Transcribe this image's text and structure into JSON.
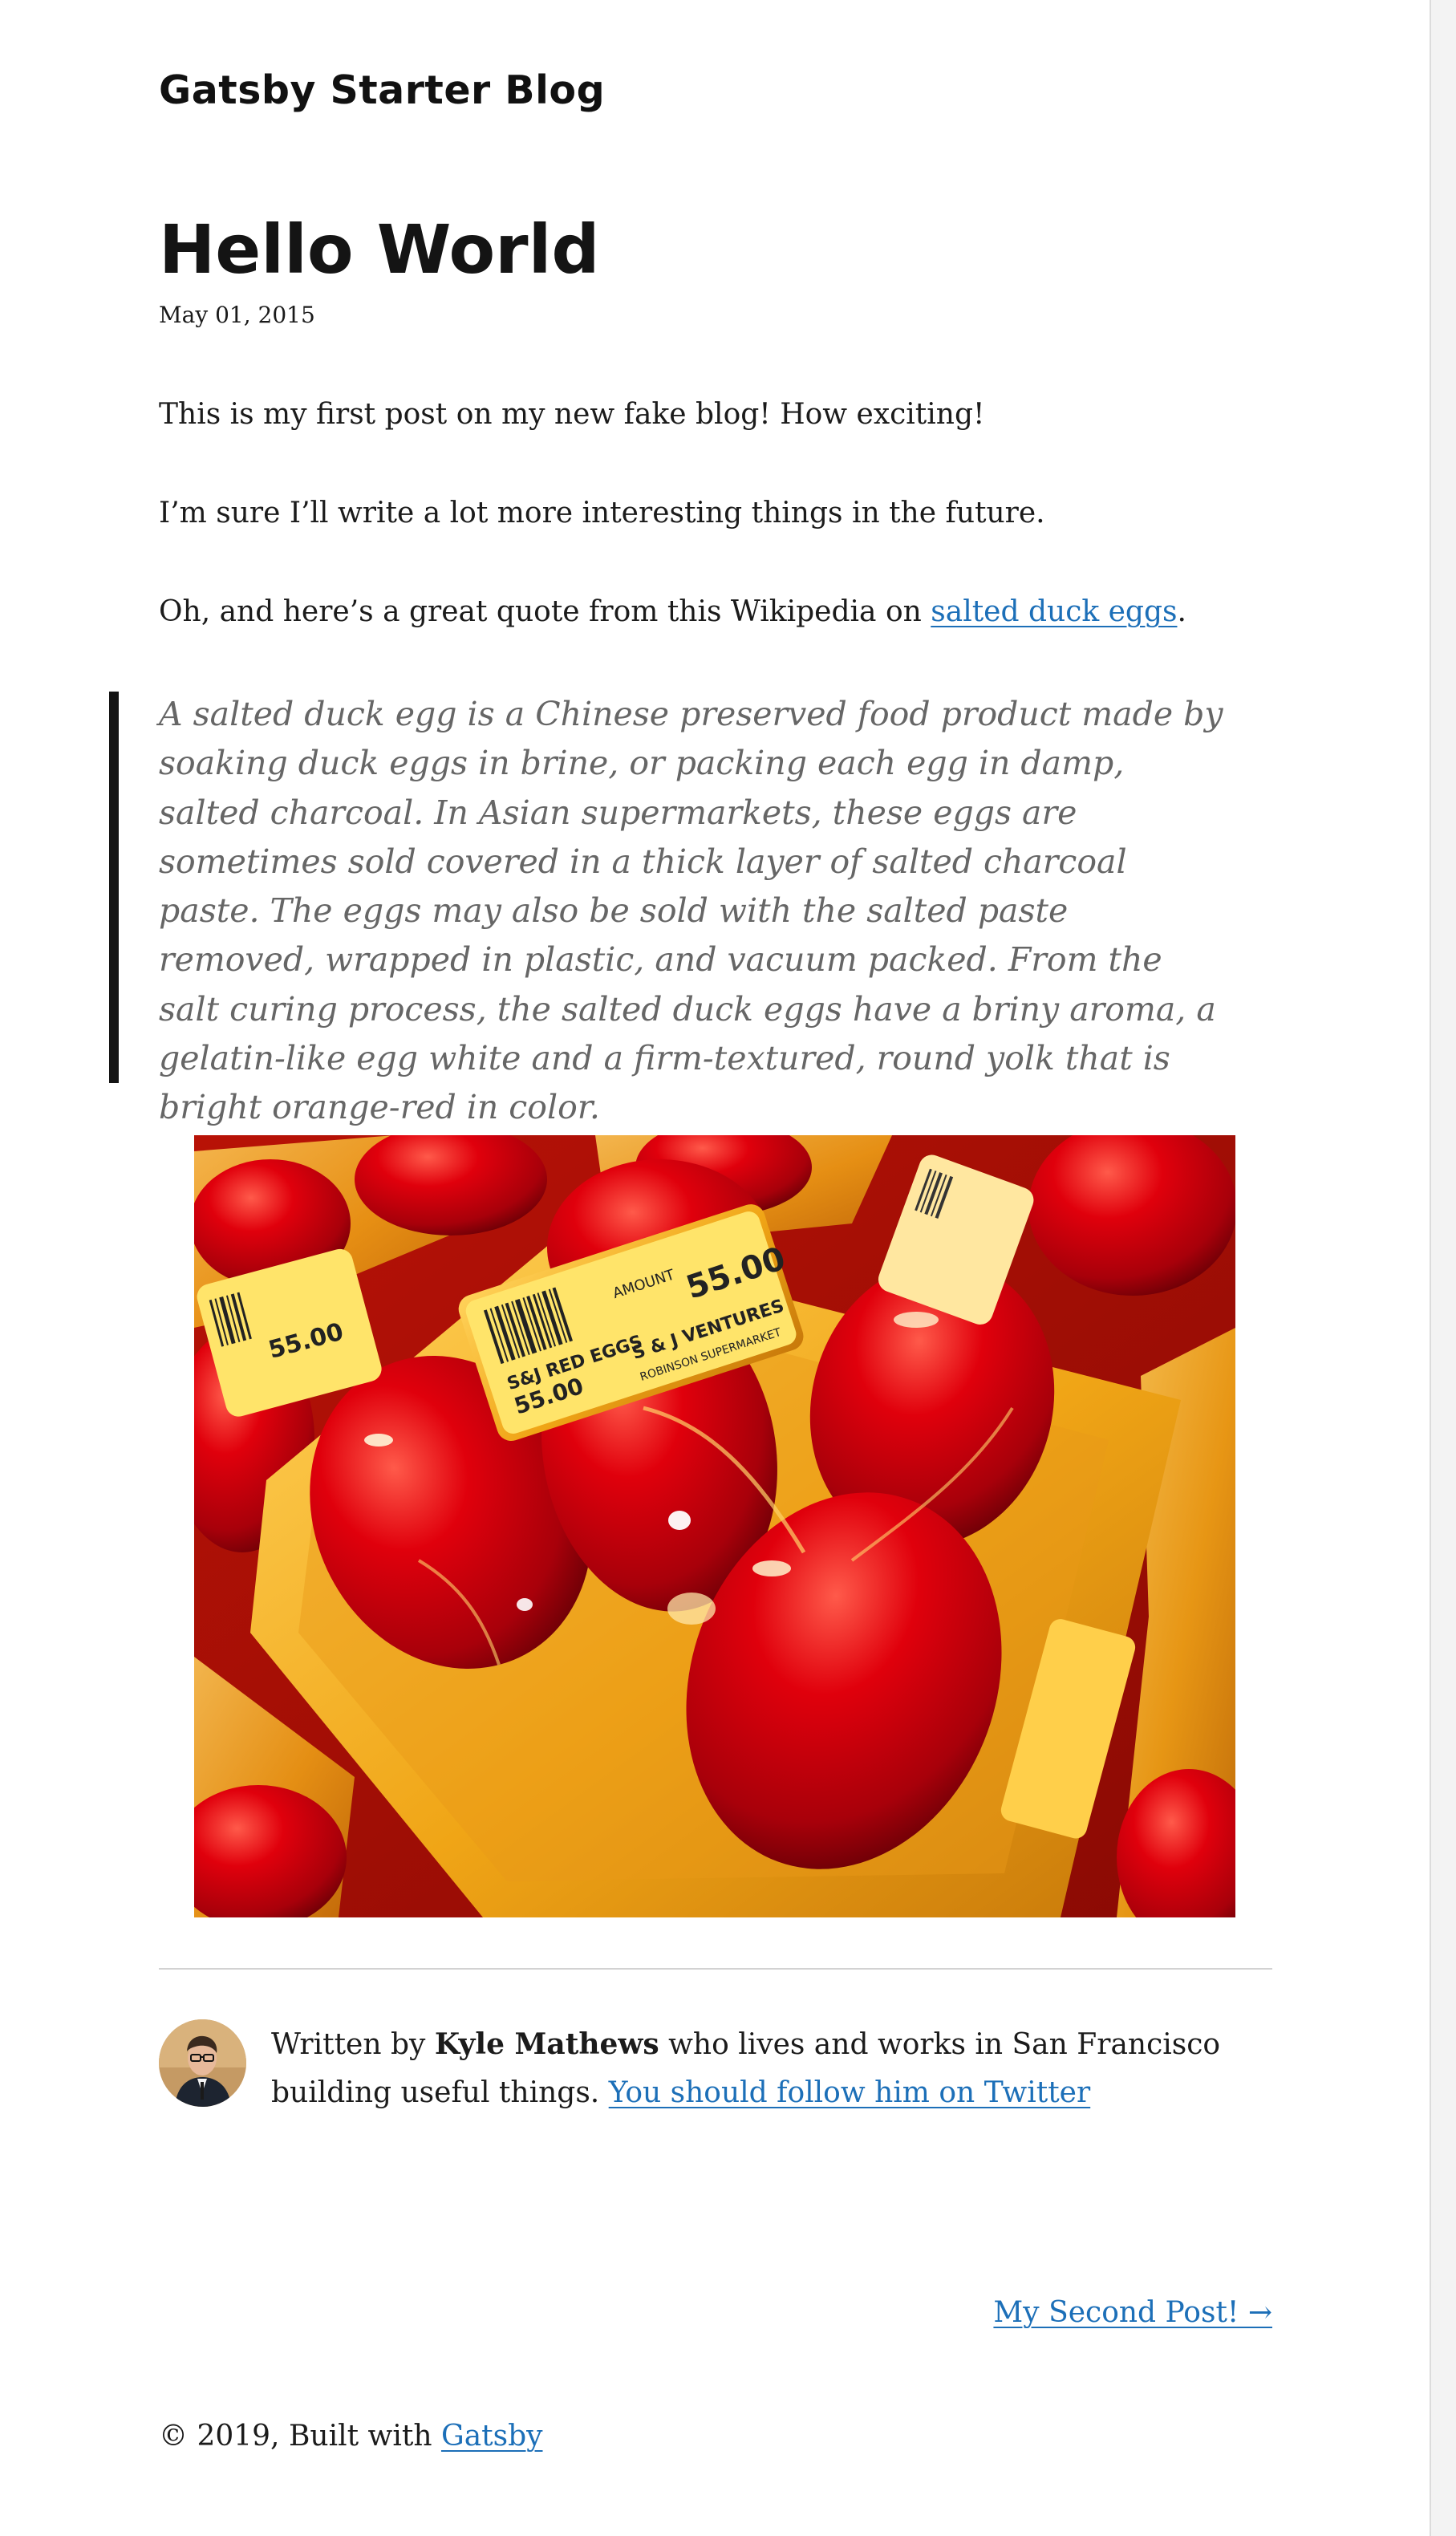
{
  "site": {
    "title": "Gatsby Starter Blog"
  },
  "post": {
    "title": "Hello World",
    "date": "May 01, 2015",
    "paragraphs": [
      "This is my first post on my new fake blog! How exciting!",
      "I’m sure I’ll write a lot more interesting things in the future."
    ],
    "quote_intro": "Oh, and here’s a great quote from this Wikipedia on ",
    "quote_link": "salted duck eggs",
    "quote_intro_end": ".",
    "blockquote": "A salted duck egg is a Chinese preserved food product made by soaking duck eggs in brine, or packing each egg in damp, salted charcoal. In Asian supermarkets, these eggs are sometimes sold covered in a thick layer of salted charcoal paste. The eggs may also be sold with the salted paste removed, wrapped in plastic, and vacuum packed. From the salt curing process, the salted duck eggs have a briny aroma, a gelatin-like egg white and a firm-textured, round yolk that is bright orange-red in color.",
    "image": {
      "labels": {
        "price": "55.00",
        "product": "S&J RED EGGS",
        "vendor": "S & J VENTURES",
        "store": "ROBINSON SUPERMARKET",
        "amount": "AMOUNT"
      }
    }
  },
  "bio": {
    "prefix": "Written by ",
    "author": "Kyle Mathews",
    "middle": " who lives and works in San Francisco building useful things. ",
    "link": "You should follow him on Twitter"
  },
  "navigation": {
    "next": "My Second Post! →"
  },
  "footer": {
    "prefix": "© 2019, Built with ",
    "link": "Gatsby"
  },
  "colors": {
    "link": "#1c6fb8",
    "text": "#1b1b1b",
    "quote_text": "#666666",
    "quote_bar": "#141414",
    "divider": "#d2d2d2",
    "egg_red": "#d4000f",
    "tray_yellow": "#f5b21a",
    "label_yellow": "#ffe46a"
  },
  "icons": {
    "next_arrow": "arrow-right-icon"
  }
}
